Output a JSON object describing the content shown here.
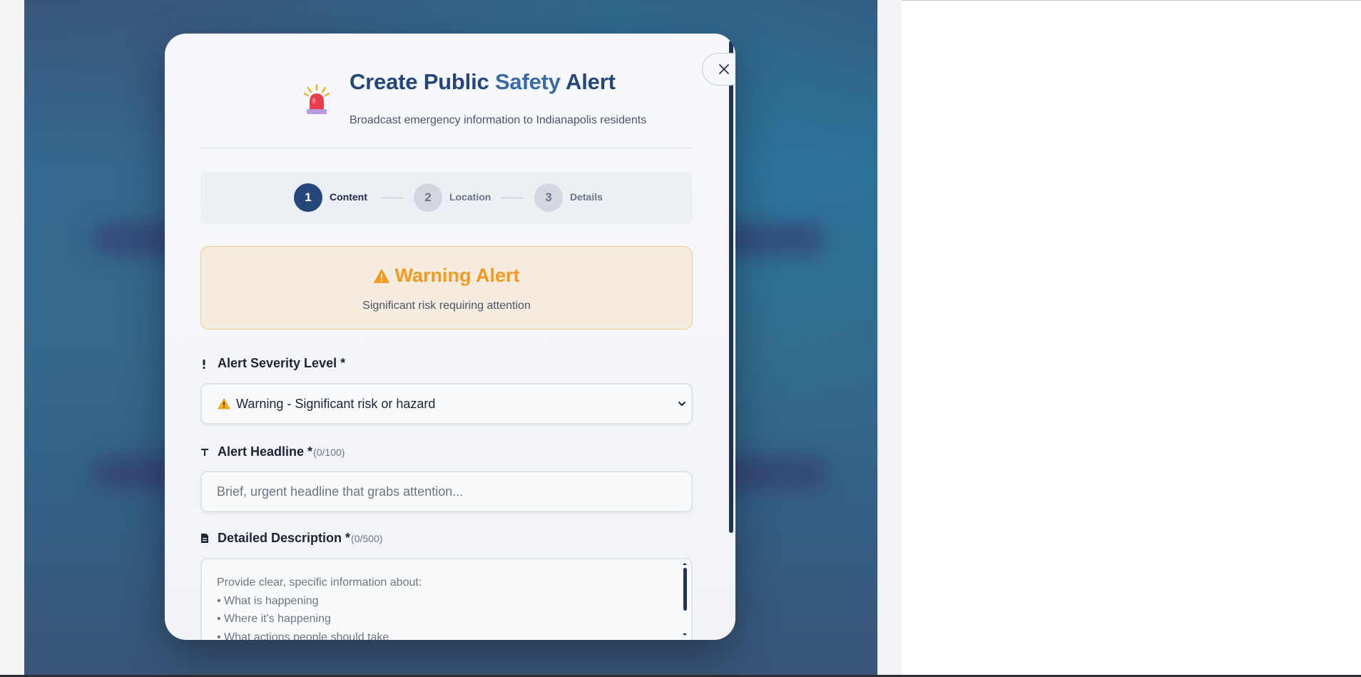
{
  "modal": {
    "title_part1": "Create Public ",
    "title_part2": "Safety",
    "title_part3": " Alert",
    "subtitle": "Broadcast emergency information to Indianapolis residents",
    "close_label": "×"
  },
  "steps": [
    {
      "number": "1",
      "label": "Content",
      "state": "active"
    },
    {
      "number": "2",
      "label": "Location",
      "state": "inactive"
    },
    {
      "number": "3",
      "label": "Details",
      "state": "inactive"
    }
  ],
  "alert_preview": {
    "title": "Warning Alert",
    "description": "Significant risk requiring attention",
    "icon": "warning-triangle-icon",
    "color": "#f29a1f"
  },
  "fields": {
    "severity": {
      "label": "Alert Severity Level *",
      "icon": "exclamation-icon",
      "selected": "Warning - Significant risk or hazard"
    },
    "headline": {
      "label": "Alert Headline *",
      "count": "(0/100)",
      "icon": "text-icon",
      "placeholder": "Brief, urgent headline that grabs attention..."
    },
    "description": {
      "label": "Detailed Description *",
      "count": "(0/500)",
      "icon": "document-icon",
      "placeholder_lines": [
        "Provide clear, specific information about:",
        "• What is happening",
        "• Where it's happening",
        "• What actions people should take"
      ]
    }
  },
  "colors": {
    "primary": "#24467a",
    "warning": "#f29a1f",
    "warning_bg": "#f6ebdf"
  }
}
